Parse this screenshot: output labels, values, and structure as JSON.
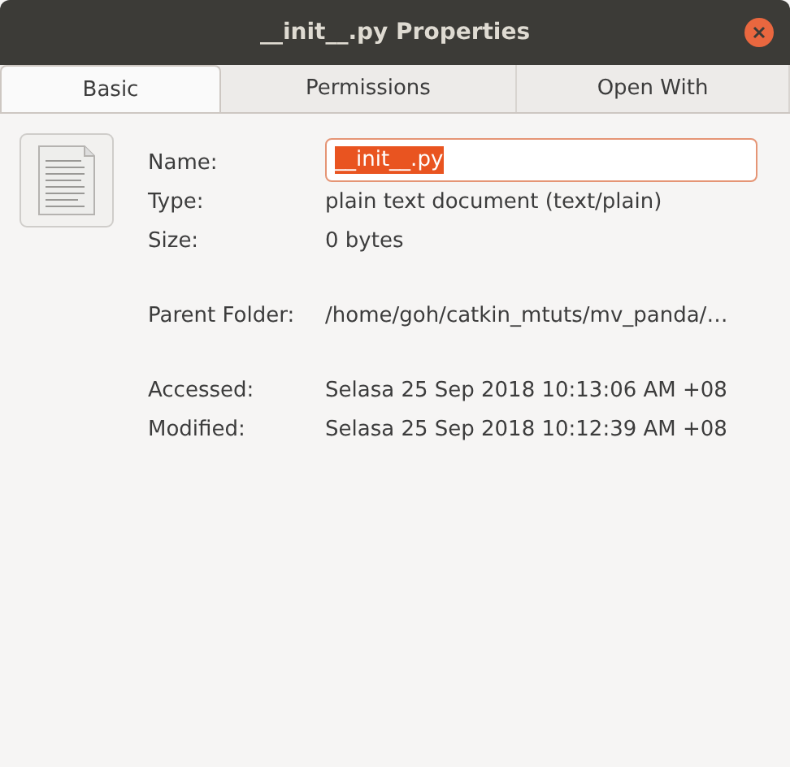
{
  "window": {
    "title": "__init__.py Properties"
  },
  "tabs": [
    {
      "label": "Basic",
      "selected": true
    },
    {
      "label": "Permissions",
      "selected": false
    },
    {
      "label": "Open With",
      "selected": false
    }
  ],
  "name_field": {
    "label": "Name:",
    "value": "__init__.py",
    "selected": true
  },
  "groups": [
    [
      {
        "label": "Type:",
        "value": "plain text document (text/plain)"
      },
      {
        "label": "Size:",
        "value": "0 bytes"
      }
    ],
    [
      {
        "label": "Parent Folder:",
        "value": "/home/goh/catkin_mtuts/mv_panda/…"
      }
    ],
    [
      {
        "label": "Accessed:",
        "value": "Selasa 25 Sep 2018 10:13:06 AM +08"
      },
      {
        "label": "Modified:",
        "value": "Selasa 25 Sep 2018 10:12:39 AM +08"
      }
    ]
  ]
}
